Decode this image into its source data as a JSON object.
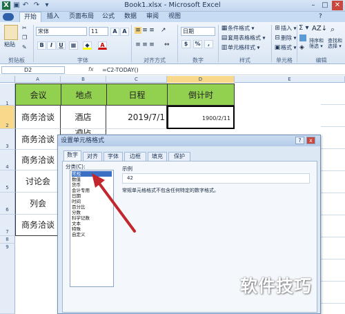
{
  "window": {
    "title": "Book1.xlsx - Microsoft Excel"
  },
  "quick_access": [
    "excel-logo",
    "save",
    "undo",
    "redo",
    "customize"
  ],
  "tabs": [
    "开始",
    "插入",
    "页面布局",
    "公式",
    "数据",
    "审阅",
    "视图"
  ],
  "ribbon": {
    "paste_label": "粘贴",
    "font_name": "宋体",
    "font_size": "11",
    "number_format": "日期",
    "bold": "B",
    "italic": "I",
    "underline": "U",
    "percent": "%",
    "comma": ",",
    "styles": [
      "条件格式 ▾",
      "套用表格格式 ▾",
      "单元格样式 ▾"
    ],
    "cells": [
      "插入 ▾",
      "删除 ▾",
      "格式 ▾"
    ],
    "sum_label": "Σ ▾",
    "sort_label": "排序和\n筛选 ▾",
    "find_label": "查找和\n选择 ▾",
    "groups": [
      "剪贴板",
      "字体",
      "对齐方式",
      "数字",
      "样式",
      "单元格",
      "编辑"
    ]
  },
  "formula_bar": {
    "name_box": "D2",
    "fx": "fx",
    "formula": "=C2-TODAY()"
  },
  "columns": [
    "A",
    "B",
    "C",
    "D",
    "E"
  ],
  "rows": [
    "1",
    "2",
    "3",
    "4",
    "5",
    "6",
    "7",
    "8",
    "9"
  ],
  "sheet": {
    "headers": [
      "会议",
      "地点",
      "日程",
      "倒计时"
    ],
    "a": [
      "商务洽谈",
      "商务洽谈",
      "商务洽谈",
      "讨论会",
      "列会",
      "商务洽谈"
    ],
    "b": [
      "酒店",
      "酒店"
    ],
    "c2": "2019/7/1",
    "d2": "1900/2/11"
  },
  "dialog": {
    "title": "设置单元格格式",
    "close": "x",
    "help": "?",
    "tabs": [
      "数字",
      "对齐",
      "字体",
      "边框",
      "填充",
      "保护"
    ],
    "category_label": "分类(C):",
    "categories": [
      "常规",
      "数值",
      "货币",
      "会计专用",
      "日期",
      "时间",
      "百分比",
      "分数",
      "科学记数",
      "文本",
      "特殊",
      "自定义"
    ],
    "sample_label": "示例",
    "sample_value": "42",
    "description": "常规单元格格式不包含任何特定的数字格式。"
  },
  "watermark": "软件技巧",
  "colors": {
    "header_green": "#92d050",
    "arrow": "#c1272d",
    "selection": "#3a6fc4"
  }
}
